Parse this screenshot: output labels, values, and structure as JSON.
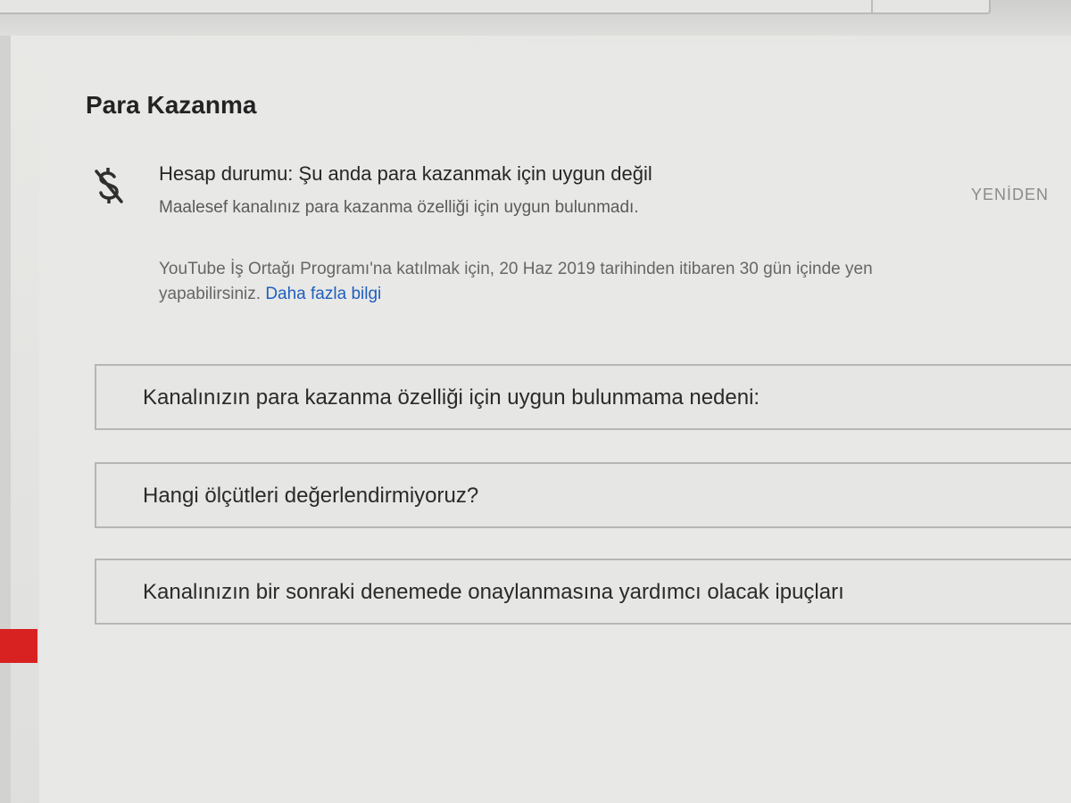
{
  "section": {
    "title": "Para Kazanma"
  },
  "status": {
    "icon": "no-money-icon",
    "title": "Hesap durumu: Şu anda para kazanmak için uygun değil",
    "subtitle": "Maalesef kanalınız para kazanma özelliği için uygun bulunmadı.",
    "retry_label": "YENİDEN"
  },
  "info": {
    "line1": "YouTube İş Ortağı Programı'na katılmak için, 20 Haz 2019 tarihinden itibaren 30 gün içinde yen",
    "line2_prefix": "yapabilirsiniz. ",
    "link_label": "Daha fazla bilgi"
  },
  "accordions": [
    {
      "label": "Kanalınızın para kazanma özelliği için uygun bulunmama nedeni:"
    },
    {
      "label": "Hangi ölçütleri değerlendirmiyoruz?"
    },
    {
      "label": "Kanalınızın bir sonraki denemede onaylanmasına yardımcı olacak ipuçları"
    }
  ],
  "colors": {
    "link": "#1f5fbf",
    "side_accent": "#d82121"
  }
}
